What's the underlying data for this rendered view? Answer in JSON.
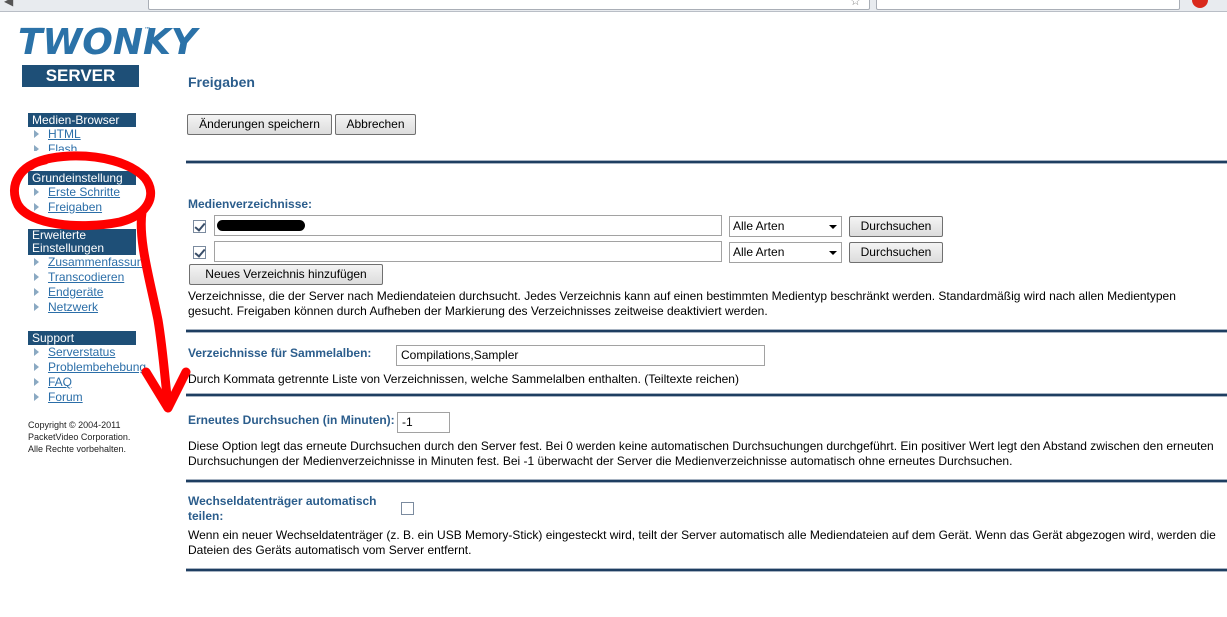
{
  "sidebar": {
    "logo": {
      "brand": "TWONKY",
      "tm": "™",
      "product": "SERVER"
    },
    "groups": [
      {
        "title": "Medien-Browser",
        "items": [
          "HTML",
          "Flash"
        ]
      },
      {
        "title": "Grundeinstellung",
        "items": [
          "Erste Schritte",
          "Freigaben"
        ]
      },
      {
        "title": "Erweiterte Einstellungen",
        "items": [
          "Zusammenfassung",
          "Transcodieren",
          "Endgeräte",
          "Netzwerk"
        ]
      },
      {
        "title": "Support",
        "items": [
          "Serverstatus",
          "Problembehebung",
          "FAQ",
          "Forum"
        ]
      }
    ],
    "copyright": [
      "Copyright © 2004-2011",
      "PacketVideo Corporation.",
      "Alle Rechte vorbehalten."
    ]
  },
  "main": {
    "title": "Freigaben",
    "save_label": "Änderungen speichern",
    "cancel_label": "Abbrechen",
    "media_dirs": {
      "label": "Medienverzeichnisse:",
      "rows": [
        {
          "checked": true,
          "path": "",
          "type": "Alle Arten",
          "browse_label": "Durchsuchen"
        },
        {
          "checked": true,
          "path": "",
          "type": "Alle Arten",
          "browse_label": "Durchsuchen"
        }
      ],
      "add_label": "Neues Verzeichnis hinzufügen",
      "description": "Verzeichnisse, die der Server nach Mediendateien durchsucht. Jedes Verzeichnis kann auf einen bestimmten Medientyp beschränkt werden. Standardmäßig wird nach allen Medientypen gesucht. Freigaben können durch Aufheben der Markierung des Verzeichnisses zeitweise deaktiviert werden."
    },
    "compilations": {
      "label": "Verzeichnisse für Sammelalben:",
      "value": "Compilations,Sampler",
      "description": "Durch Kommata getrennte Liste von Verzeichnissen, welche Sammelalben enthalten. (Teiltexte reichen)"
    },
    "rescan": {
      "label": "Erneutes Durchsuchen (in Minuten):",
      "value": "-1",
      "description": "Diese Option legt das erneute Durchsuchen durch den Server fest. Bei 0 werden keine automatischen Durchsuchungen durchgeführt. Ein positiver Wert legt den Abstand zwischen den erneuten Durchsuchungen der Medienverzeichnisse in Minuten fest. Bei -1 überwacht der Server die Medienverzeichnisse automatisch ohne erneutes Durchsuchen."
    },
    "removable": {
      "label": "Wechseldatenträger automatisch teilen:",
      "checked": false,
      "description": "Wenn ein neuer Wechseldatenträger (z. B. ein USB Memory-Stick) eingesteckt wird, teilt der Server automatisch alle Mediendateien auf dem Gerät. Wenn das Gerät abgezogen wird, werden die Dateien des Geräts automatisch vom Server entfernt."
    }
  },
  "colors": {
    "accent": "#1e4f77",
    "link": "#2b6ea8",
    "heading": "#2b5d8c",
    "annotation": "#ff0000"
  }
}
